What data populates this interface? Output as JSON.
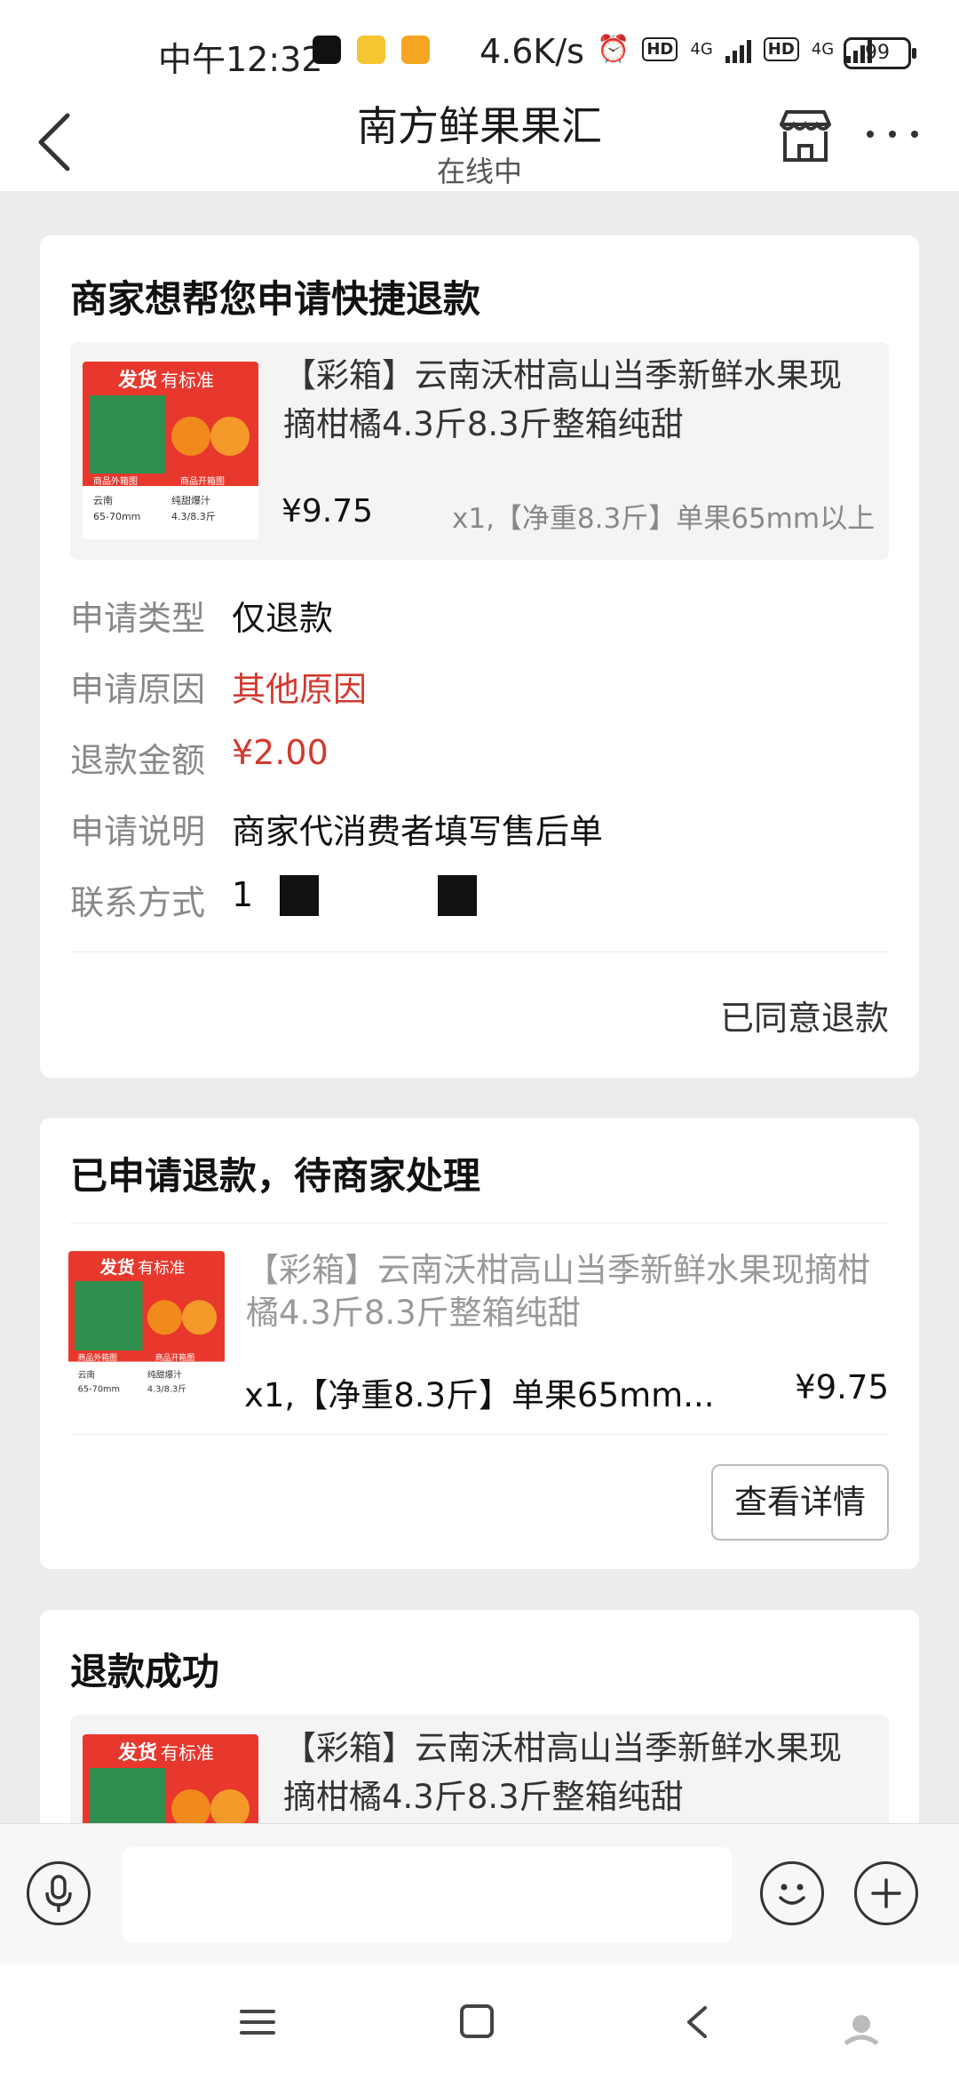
{
  "status_bar": {
    "time": "中午12:32",
    "network_speed": "4.6K/s",
    "hd1": "HD",
    "signal1": "4G",
    "hd2": "HD",
    "signal2": "4G",
    "battery": "99"
  },
  "header": {
    "title": "南方鲜果果汇",
    "status": "在线中"
  },
  "card1": {
    "title": "商家想帮您申请快捷退款",
    "product": {
      "title": "【彩箱】云南沃柑高山当季新鲜水果现摘柑橘4.3斤8.3斤整箱纯甜",
      "price": "¥9.75",
      "spec": "x1,【净重8.3斤】单果65mm以上"
    },
    "rows": [
      {
        "label": "申请类型",
        "value": "仅退款"
      },
      {
        "label": "申请原因",
        "value": "其他原因"
      },
      {
        "label": "退款金额",
        "value": "¥2.00"
      },
      {
        "label": "申请说明",
        "value": "商家代消费者填写售后单"
      },
      {
        "label": "联系方式",
        "value": "1"
      }
    ],
    "action": "已同意退款"
  },
  "card2": {
    "title": "已申请退款，待商家处理",
    "product": {
      "title": "【彩箱】云南沃柑高山当季新鲜水果现摘柑橘4.3斤8.3斤整箱纯甜",
      "spec": "x1,【净重8.3斤】单果65mm...",
      "price": "¥9.75"
    },
    "button": "查看详情"
  },
  "card3": {
    "title": "退款成功",
    "product": {
      "title": "【彩箱】云南沃柑高山当季新鲜水果现摘柑橘4.3斤8.3斤整箱纯甜"
    }
  },
  "thumb": {
    "banner_a": "发货",
    "banner_b": "有标准",
    "label_left": "商品外箱图",
    "label_right": "商品开箱图",
    "origin": "云南",
    "size": "65-70mm",
    "taste": "纯甜爆汁",
    "weight": "4.3/8.3斤"
  },
  "colors": {
    "accent_red": "#d23a2f",
    "banner_red": "#e8372c"
  }
}
